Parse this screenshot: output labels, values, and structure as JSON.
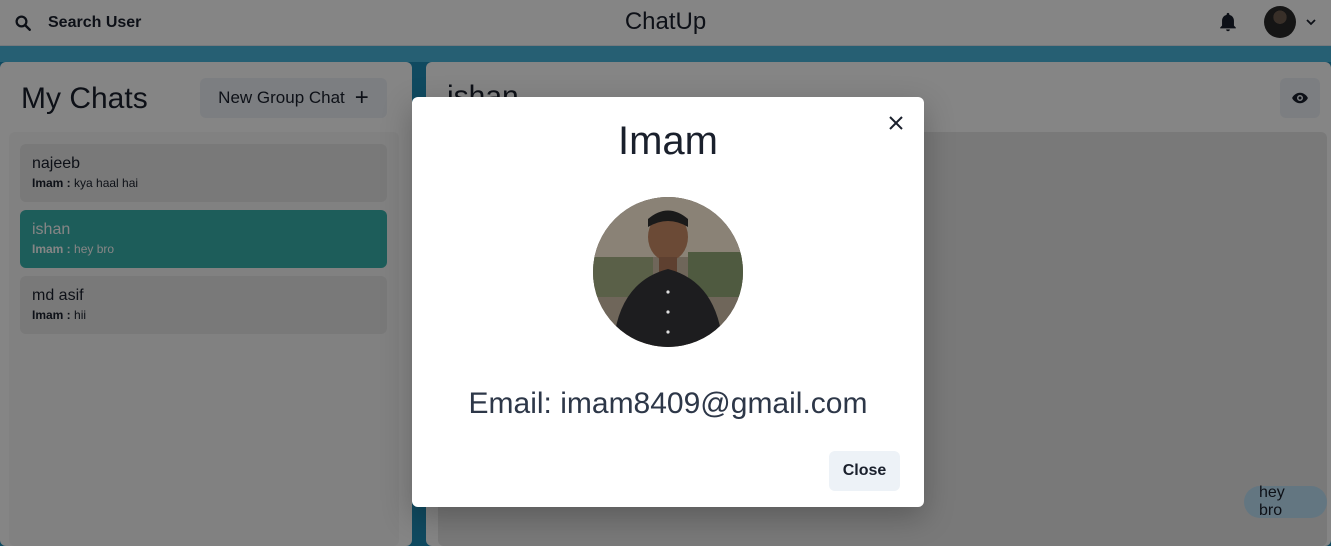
{
  "topbar": {
    "search_label": "Search User",
    "app_title": "ChatUp"
  },
  "left_panel": {
    "title": "My Chats",
    "new_group_label": "New Group Chat",
    "chats": [
      {
        "name": "najeeb",
        "sender": "Imam :",
        "last_message": "kya haal hai",
        "active": false
      },
      {
        "name": "ishan",
        "sender": "Imam :",
        "last_message": "hey bro",
        "active": true
      },
      {
        "name": "md asif",
        "sender": "Imam :",
        "last_message": "hii",
        "active": false
      }
    ]
  },
  "right_panel": {
    "chat_title": "ishan",
    "messages": [
      {
        "text": "hey bro"
      }
    ]
  },
  "modal": {
    "title": "Imam",
    "email": "Email: imam8409@gmail.com",
    "close_label": "Close"
  },
  "colors": {
    "accent_teal": "#38b2ac",
    "header_blue": "#49b6dc",
    "bubble_blue": "#bee3f8"
  },
  "icons": [
    "search-icon",
    "bell-icon",
    "chevron-down-icon",
    "plus-icon",
    "eye-icon",
    "close-icon"
  ]
}
